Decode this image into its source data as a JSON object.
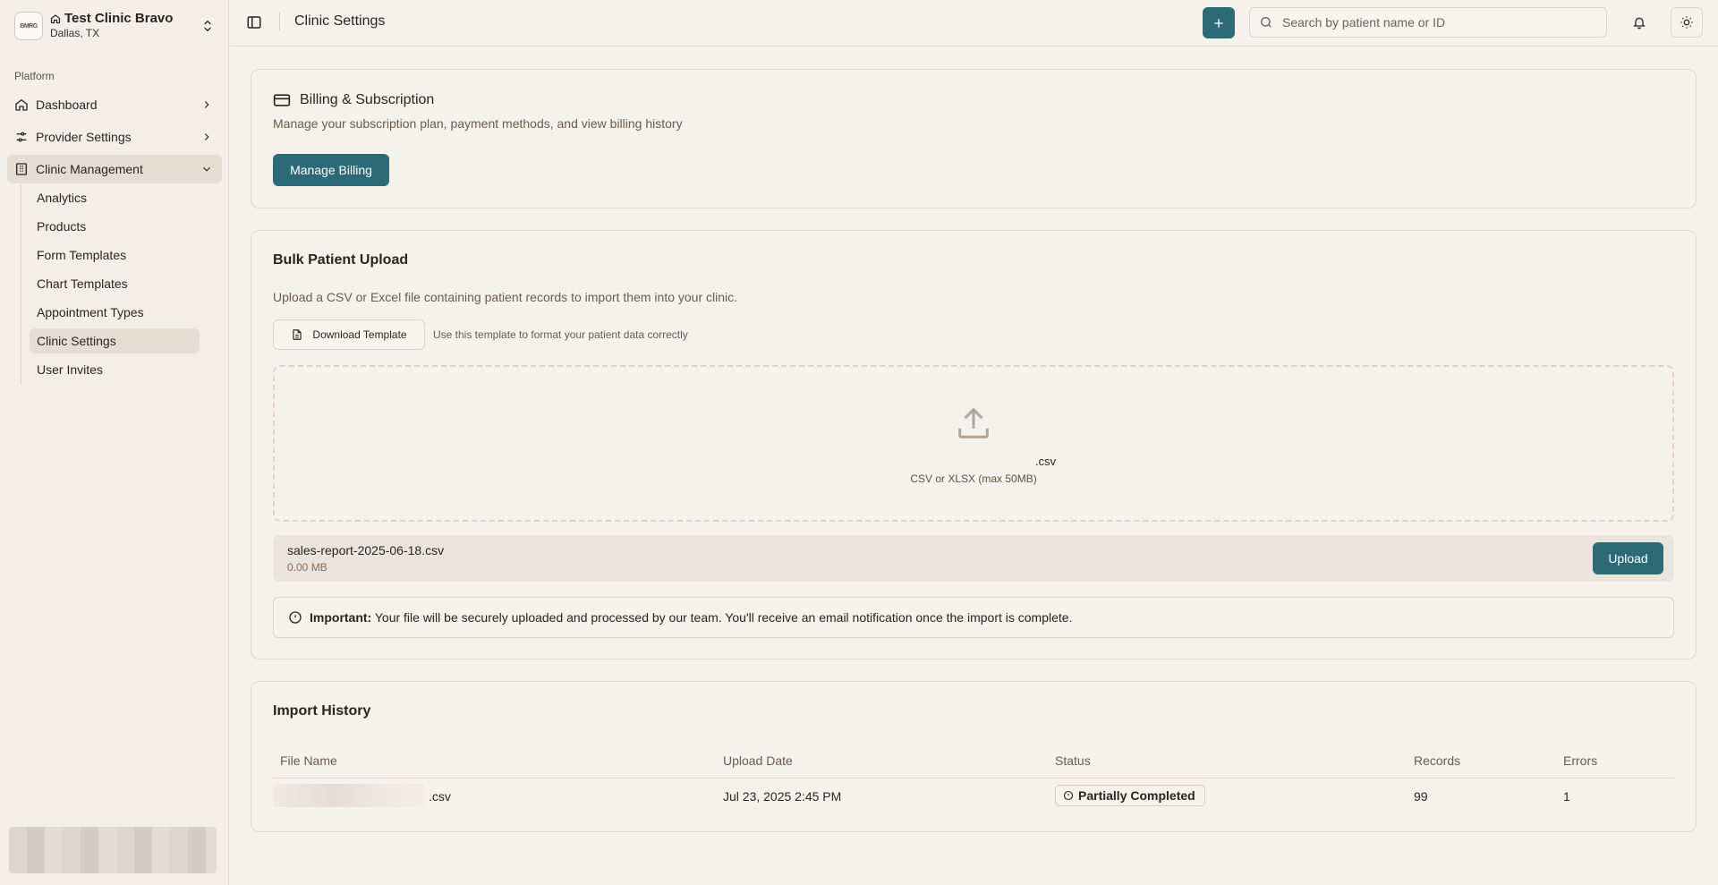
{
  "clinic": {
    "name": "Test Clinic Bravo",
    "location": "Dallas, TX",
    "logo_text": "BMRG"
  },
  "sidebar": {
    "section_label": "Platform",
    "items": [
      {
        "label": "Dashboard"
      },
      {
        "label": "Provider Settings"
      },
      {
        "label": "Clinic Management"
      }
    ],
    "sub_items": [
      {
        "label": "Analytics"
      },
      {
        "label": "Products"
      },
      {
        "label": "Form Templates"
      },
      {
        "label": "Chart Templates"
      },
      {
        "label": "Appointment Types"
      },
      {
        "label": "Clinic Settings"
      },
      {
        "label": "User Invites"
      }
    ],
    "active_sub": "Clinic Settings"
  },
  "header": {
    "title": "Clinic Settings",
    "search_placeholder": "Search by patient name or ID"
  },
  "billing": {
    "title": "Billing & Subscription",
    "description": "Manage your subscription plan, payment methods, and view billing history",
    "button": "Manage Billing"
  },
  "bulk_upload": {
    "title": "Bulk Patient Upload",
    "description": "Upload a CSV or Excel file containing patient records to import them into your clinic.",
    "template_button": "Download Template",
    "template_hint": "Use this template to format your patient data correctly",
    "dropzone_filename_fragment": ".csv",
    "dropzone_hint": "CSV or XLSX (max 50MB)",
    "selected_file": {
      "name": "sales-report-2025-06-18.csv",
      "size": "0.00 MB"
    },
    "upload_button": "Upload",
    "notice_label": "Important:",
    "notice_text": "Your file will be securely uploaded and processed by our team. You'll receive an email notification once the import is complete."
  },
  "import_history": {
    "title": "Import History",
    "columns": [
      "File Name",
      "Upload Date",
      "Status",
      "Records",
      "Errors"
    ],
    "rows": [
      {
        "file_suffix": ".csv",
        "date": "Jul 23, 2025 2:45 PM",
        "status": "Partially Completed",
        "records": "99",
        "errors": "1"
      }
    ]
  },
  "colors": {
    "accent": "#2b6a76",
    "background": "#f5f1ec",
    "muted_text": "#6b5b4c"
  }
}
